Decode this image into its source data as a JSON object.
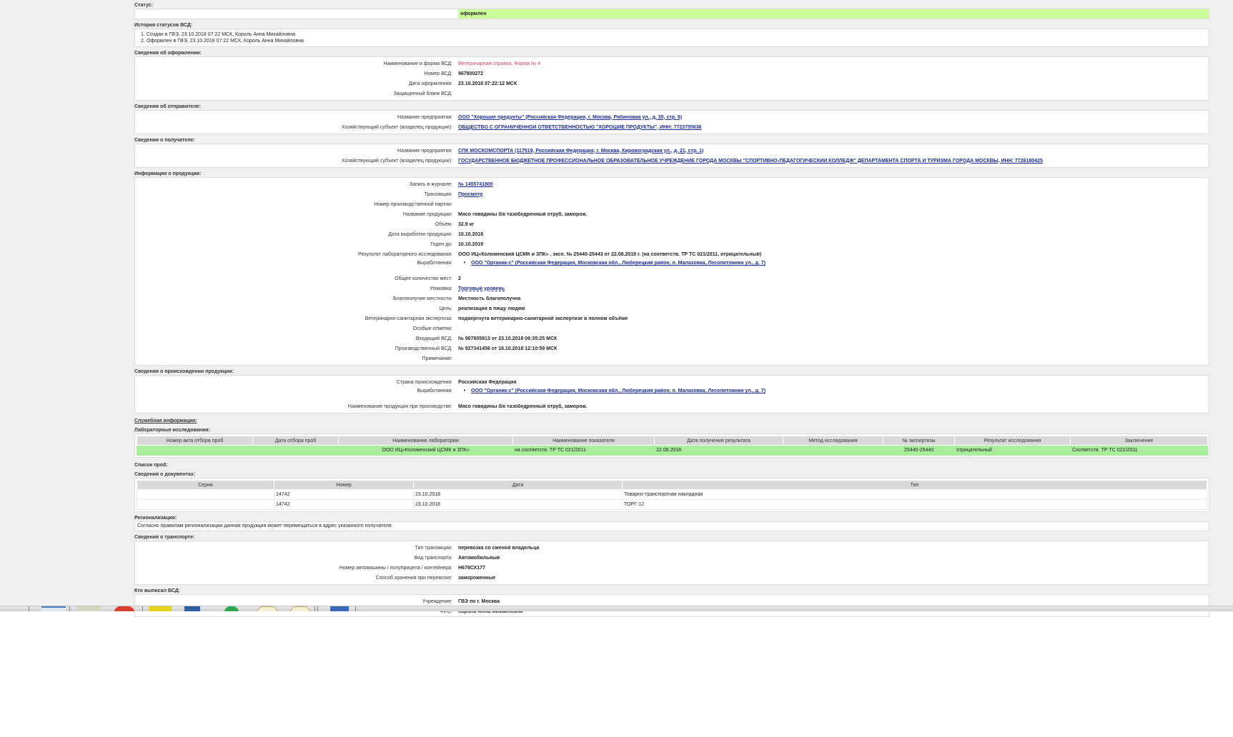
{
  "status": {
    "title": "Статус:",
    "value": "оформлен"
  },
  "history": {
    "title": "История статусов ВСД:",
    "items": [
      {
        "num": "1.",
        "text": "Создан в ГВЭ, 23.10.2018 07:22 МСК, Король Анна Михайловна"
      },
      {
        "num": "2.",
        "text": "Оформлен в ГВЭ, 23.10.2018 07:22 МСК, Король Анна Михайловна"
      }
    ]
  },
  "registration": {
    "title": "Сведения об оформлении:",
    "rows": [
      {
        "label": "Наименование и форма ВСД:",
        "value": "Ветеринарная справка, Форма № 4"
      },
      {
        "label": "Номер ВСД:",
        "value": "967800272"
      },
      {
        "label": "Дата оформления:",
        "value": "23.10.2018 07:22:12 МСК"
      },
      {
        "label": "Защищенный бланк ВСД:",
        "value": ""
      }
    ]
  },
  "sender": {
    "title": "Сведения об отправителе:",
    "rows": [
      {
        "label": "Название предприятия:",
        "value": "ООО \"Хорошие продукты\" (Российская Федерация, г. Москва, Рябиновая ул., д. 35, стр. 6)"
      },
      {
        "label": "Хозяйствующий субъект (владелец продукции):",
        "value": "ОБЩЕСТВО С ОГРАНИЧЕННОЙ ОТВЕТСТВЕННОСТЬЮ \"ХОРОШИЕ ПРОДУКТЫ\", ИНН: 7723755636"
      }
    ]
  },
  "receiver": {
    "title": "Сведения о получателе:",
    "rows": [
      {
        "label": "Название предприятия:",
        "value": "СПК МОСКОМСПОРТА (117519, Российская Федерация, г. Москва, Кировоградская ул., д. 21, стр. 1)"
      },
      {
        "label": "Хозяйствующий субъект (владелец продукции):",
        "value": "ГОСУДАРСТВЕННОЕ БЮДЖЕТНОЕ ПРОФЕССИОНАЛЬНОЕ ОБРАЗОВАТЕЛЬНОЕ УЧРЕЖДЕНИЕ ГОРОДА МОСКВЫ \"СПОРТИВНО-ПЕДАГОГИЧЕСКИЙ КОЛЛЕДЖ\" ДЕПАРТАМЕНТА СПОРТА И ТУРИЗМА ГОРОДА МОСКВЫ, ИНН: 7726180425"
      }
    ]
  },
  "product": {
    "title": "Информация о продукции:",
    "rows_a": [
      {
        "label": "Запись в журнале:",
        "value": "№ 1455741800",
        "link": true
      },
      {
        "label": "Транзакция:",
        "value": "Просмотр",
        "link": true
      },
      {
        "label": "Номер производственной партии:",
        "value": ""
      },
      {
        "label": "Название продукции:",
        "value": "Мясо говядины б/к тазобедренный отруб, заморож."
      },
      {
        "label": "Объём:",
        "value": "32.9 кг"
      },
      {
        "label": "Дата выработки продукции:",
        "value": "10.10.2018"
      },
      {
        "label": "Годен до:",
        "value": "10.10.2019"
      },
      {
        "label": "Результат лабораторного исследования:",
        "value": "ООО ИЦ«Коломенский ЦСМК и ЗПК» , эксп. № 25440-25443 от 22.08.2018 г. (на соответств. ТР ТС 021/2011, отрицательный)"
      }
    ],
    "produced_label": "Выработанная:",
    "produced_value": "ООО \"Органик-с\" (Российская Федерация, Московская обл., Люберецкий район, п. Малаховка, Лесопитомник ул., д. 7)",
    "rows_b": [
      {
        "label": "Общее количество мест:",
        "value": "2"
      },
      {
        "label": "Упаковка:",
        "value": "Торговый уровень",
        "link": true
      },
      {
        "label": "Благополучие местности:",
        "value": "Местность благополучна"
      },
      {
        "label": "Цель:",
        "value": "реализация в пищу людям"
      },
      {
        "label": "Ветеринарно-санитарная экспертиза:",
        "value": "подвергнута ветеринарно-санитарной экспертизе в полном объёме"
      },
      {
        "label": "Особые отметки:",
        "value": ""
      },
      {
        "label": "Входящий ВСД:",
        "value": "№ 967805913 от 23.10.2018 06:35:25 МСК"
      },
      {
        "label": "Производственный ВСД:",
        "value": "№ 927341456 от 16.10.2018 12:10:59 МСК"
      },
      {
        "label": "Примечание:",
        "value": ""
      }
    ]
  },
  "origin": {
    "title": "Сведения о происхождении продукции:",
    "country_label": "Страна происхождения:",
    "country_value": "Российская Федерация",
    "produced_label": "Выработанная:",
    "produced_value": "ООО \"Органик-с\" (Российская Федерация, Московская обл., Люберецкий район, п. Малаховка, Лесопитомник ул., д. 7)",
    "name_label": "Наименование продукции при производстве:",
    "name_value": "Мясо говядины б/к тазобедренный отруб, заморож."
  },
  "service": {
    "title": "Служебная информация:"
  },
  "lab": {
    "title": "Лабораторные исследования:",
    "headers": [
      "Номер акта отбора проб",
      "Дата отбора проб",
      "Наименование лаборатории",
      "Наименование показателя",
      "Дата получения результата",
      "Метод исследования",
      "№ экспертизы",
      "Результат исследования",
      "Заключение"
    ],
    "rows": [
      [
        "",
        "",
        "ООО ИЦ«Коломенский ЦСМК и ЗПК»",
        "на соответств. ТР ТС 021/2011",
        "22.08.2018",
        "",
        "25440-25443",
        "отрицательный",
        "Соответств. ТР ТС 021/2011"
      ]
    ]
  },
  "samples": {
    "title": "Список проб:"
  },
  "documents": {
    "title": "Сведения о документах:",
    "headers": [
      "Серия",
      "Номер",
      "Дата",
      "Тип"
    ],
    "rows": [
      [
        "",
        "14742",
        "23.10.2018",
        "Товарно-транспортная накладная"
      ],
      [
        "",
        "14742",
        "23.10.2018",
        "ТОРГ-12"
      ]
    ]
  },
  "regionalization": {
    "title": "Регионализация:",
    "text": "Согласно правилам регионализации данная продукция может перемещаться в адрес указанного получателя"
  },
  "transport": {
    "title": "Сведения о транспорте:",
    "rows": [
      {
        "label": "Тип транзакции:",
        "value": "перевозка со сменой владельца"
      },
      {
        "label": "Вид транспорта:",
        "value": "Автомобильный"
      },
      {
        "label": "Номер автомашины / полуприцепа / контейнера:",
        "value": "Н678СХ177"
      },
      {
        "label": "Способ хранения при перевозке:",
        "value": "замороженные"
      }
    ]
  },
  "issuer": {
    "title": "Кто выписал ВСД:",
    "rows": [
      {
        "label": "Учреждение:",
        "value": "ГВЭ по г. Москва"
      },
      {
        "label": "ФИО:",
        "value": "Король Анна Михайловна"
      }
    ]
  },
  "colors": {
    "status_bg": "#ccff99",
    "lab_row_bg": "#a8ee9c",
    "link": "#1c2e8f",
    "form_name": "#d0485c"
  },
  "taskbar": {
    "icons": [
      "explorer-icon",
      "calc-icon",
      "browser-icon",
      "folder-icon",
      "monitor-icon",
      "chrome-icon",
      "clock-icon",
      "clock-icon",
      "app-icon"
    ]
  }
}
